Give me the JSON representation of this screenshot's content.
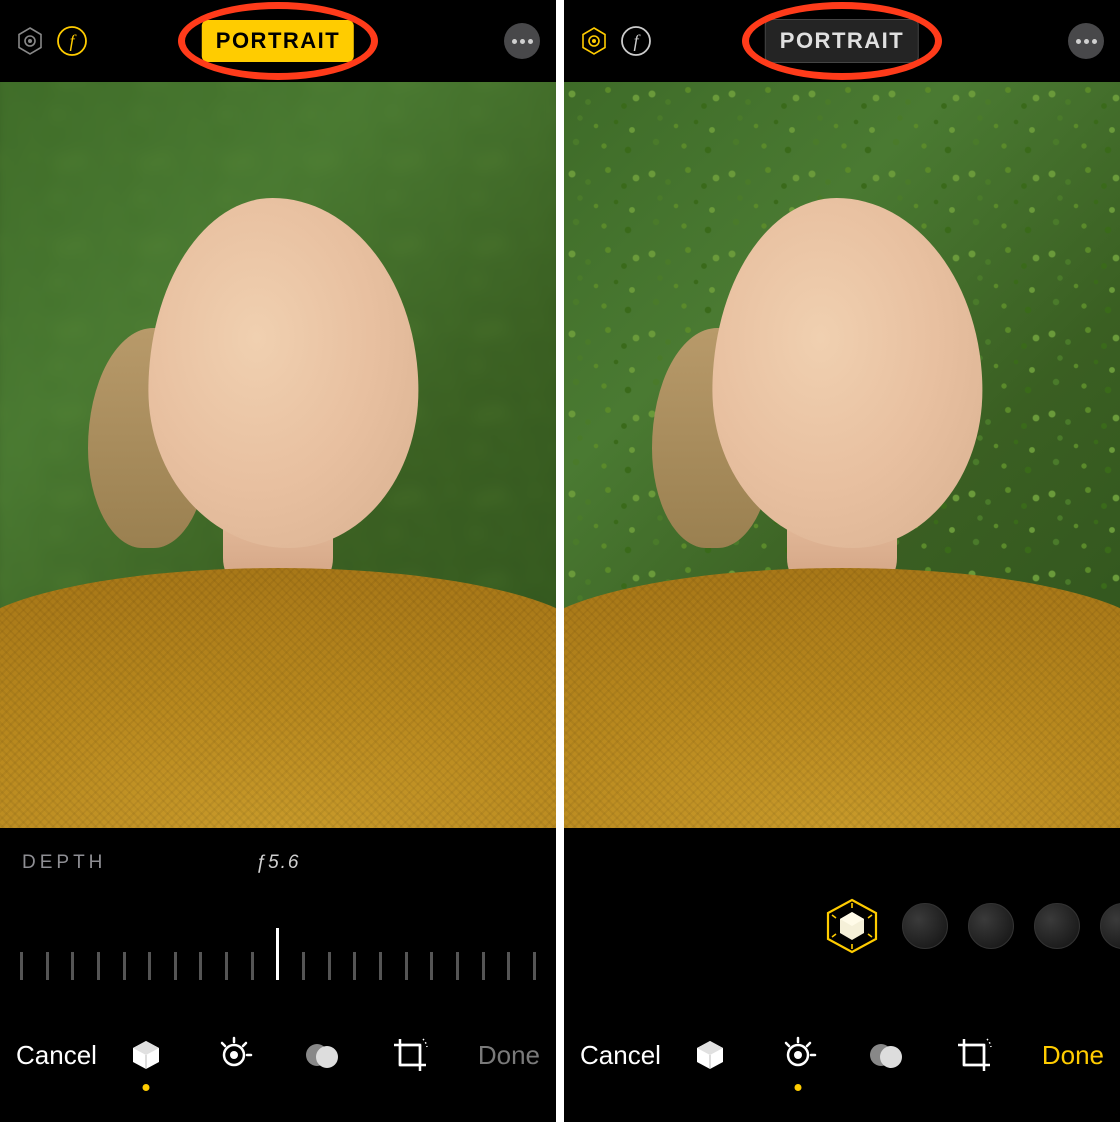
{
  "left": {
    "topbar": {
      "portrait_label": "PORTRAIT",
      "portrait_active": true
    },
    "depth": {
      "label": "DEPTH",
      "value": "ƒ5.6",
      "tick_count": 21,
      "current_tick_index": 10
    },
    "toolbar": {
      "cancel": "Cancel",
      "done": "Done",
      "done_active": false,
      "active_tool_index": 0
    }
  },
  "right": {
    "topbar": {
      "portrait_label": "PORTRAIT",
      "portrait_active": false
    },
    "lighting": {
      "selected_index": 0,
      "option_count": 4
    },
    "toolbar": {
      "cancel": "Cancel",
      "done": "Done",
      "done_active": true,
      "active_tool_index": 1
    }
  },
  "colors": {
    "accent": "#ffcc00",
    "annotation": "#ff3b1a"
  },
  "icons": {
    "live_photo": "live-photo-icon",
    "aperture": "aperture-f-icon",
    "more": "more-icon",
    "portrait_tool": "portrait-cube-icon",
    "adjust_tool": "adjust-dial-icon",
    "filters_tool": "filters-circles-icon",
    "crop_tool": "crop-rotate-icon",
    "lighting_cube": "lighting-cube-icon"
  }
}
